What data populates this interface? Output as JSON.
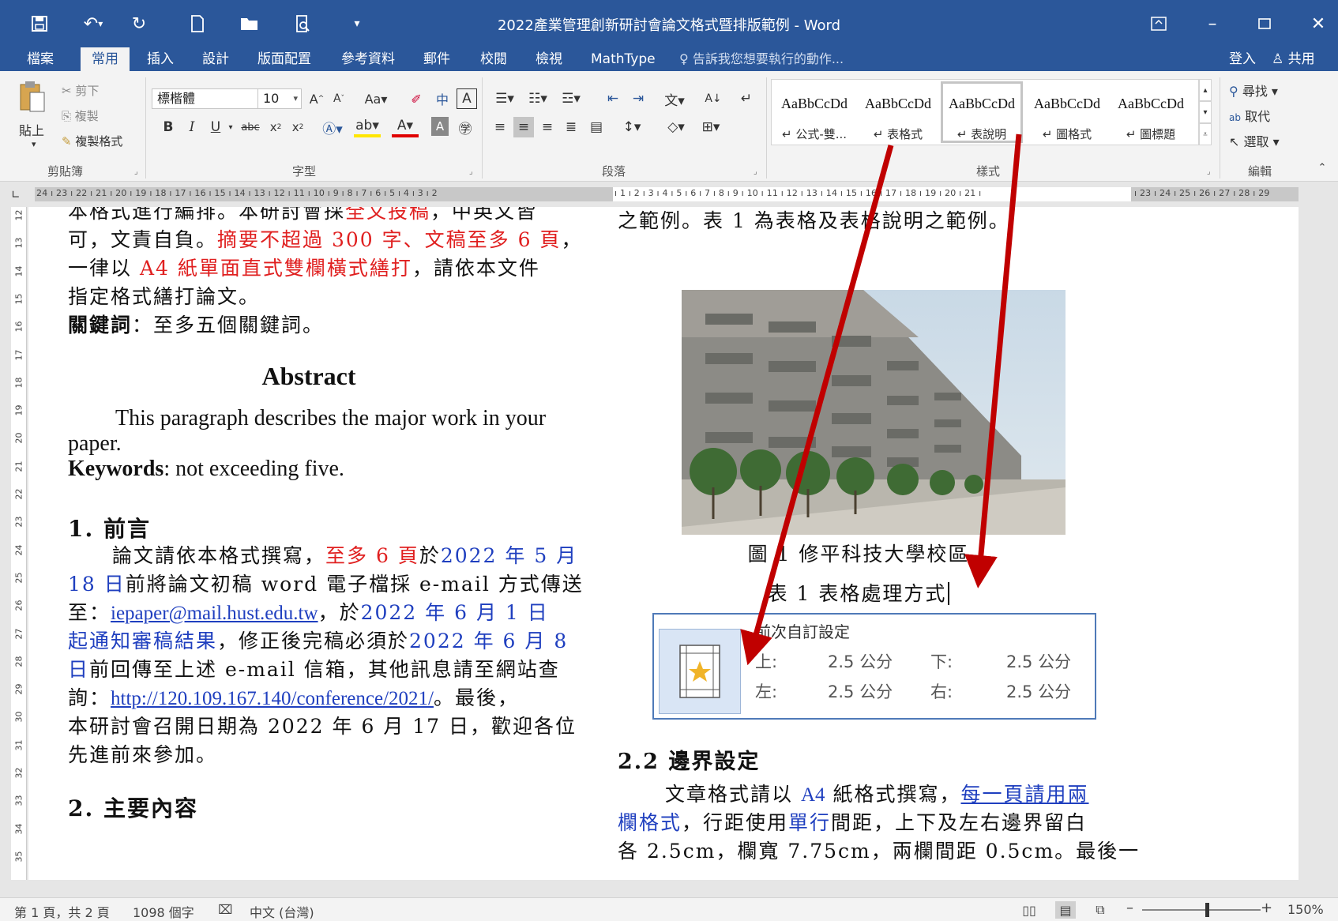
{
  "window": {
    "title": "2022產業管理創新研討會論文格式暨排版範例 - Word"
  },
  "tabs": [
    "檔案",
    "常用",
    "插入",
    "設計",
    "版面配置",
    "參考資料",
    "郵件",
    "校閱",
    "檢視",
    "MathType"
  ],
  "active_tab": "常用",
  "tell_me": "告訴我您想要執行的動作...",
  "signin": "登入",
  "share": "共用",
  "ribbon": {
    "clipboard": {
      "paste": "貼上",
      "cut": "剪下",
      "copy": "複製",
      "format_painter": "複製格式",
      "label": "剪貼簿"
    },
    "font": {
      "name": "標楷體",
      "size": "10",
      "label": "字型",
      "change_case": "Aa"
    },
    "paragraph": {
      "label": "段落"
    },
    "styles": {
      "label": "樣式",
      "items": [
        {
          "sample": "AaBbCcDd",
          "name": "公式-雙..."
        },
        {
          "sample": "AaBbCcDd",
          "name": "表格式"
        },
        {
          "sample": "AaBbCcDd",
          "name": "表說明"
        },
        {
          "sample": "AaBbCcDd",
          "name": "圖格式"
        },
        {
          "sample": "AaBbCcDd",
          "name": "圖標題"
        }
      ]
    },
    "editing": {
      "find": "尋找",
      "replace": "取代",
      "select": "選取",
      "label": "編輯"
    }
  },
  "ruler": {
    "left_nums": "24 ı 23 ı 22 ı 21 ı 20 ı 19 ı 18 ı 17 ı 16 ı 15 ı 14 ı 13 ı 12 ı 11 ı 10 ı 9 ı 8 ı 7 ı 6 ı 5 ı 4 ı 3 ı 2",
    "right_nums": "ı 1 ı 2 ı 3 ı 4 ı 5 ı 6 ı 7 ı 8 ı 9 ı 10 ı 11 ı 12 ı 13 ı 14 ı 15 ı 16 ı 17 ı 18 ı 19 ı 20 ı 21 ı",
    "end_nums": "ı 23 ı 24 ı 25 ı 26 ı 27 ı 28 ı 29",
    "vertical": [
      "12",
      "13",
      "14",
      "15",
      "16",
      "17",
      "18",
      "19",
      "20",
      "21",
      "22",
      "23",
      "24",
      "25",
      "26",
      "27",
      "28",
      "29",
      "30",
      "31",
      "32",
      "33",
      "34",
      "35"
    ]
  },
  "doc": {
    "left": {
      "l1a": "本格式進行編排。本研討會採",
      "l1b": "全文投稿",
      "l1c": "，中英文皆",
      "l2a": "可，文責自負。",
      "l2b": "摘要不超過 300 字、文稿至多 6 頁",
      "l2c": "，",
      "l3a": "一律以 ",
      "l3b": "A4 紙單面直式雙欄橫式繕打",
      "l3c": "，請依本文件",
      "l4": "指定格式繕打論文。",
      "kw_label": "關鍵詞",
      "kw_text": "：至多五個關鍵詞。",
      "abstract_title": "Abstract",
      "abs1": "This paragraph describes the major work in your",
      "abs2": "paper.",
      "kw_en_label": "Keywords",
      "kw_en_text": ": not exceeding five.",
      "h1": "1. 前言",
      "p1a": "論文請依本格式撰寫，",
      "p1b": "至多 6 頁",
      "p1c": "於",
      "p1d": "2022 年 5 月",
      "p2a": "18 日",
      "p2b": "前將論文初稿 word 電子檔採 e-mail 方式傳送",
      "p3a": "至：",
      "p3b": "iepaper@mail.hust.edu.tw",
      "p3c": "，於",
      "p3d": "2022 年 6 月 1 日",
      "p4a": "起通知審稿結果",
      "p4b": "，修正後完稿必須於",
      "p4c": "2022 年 6 月 8",
      "p5a": "日",
      "p5b": "前回傳至上述 e-mail 信箱，其他訊息請至網站查",
      "p6a": "詢：",
      "p6b": "http://120.109.167.140/conference/2021/",
      "p6c": "。最後，",
      "p7": "本研討會召開日期為 2022 年 6 月 17 日，歡迎各位",
      "p8": "先進前來參加。",
      "h2": "2. 主要內容"
    },
    "right": {
      "r1": "之範例。表 1 為表格及表格說明之範例。",
      "fig_caption": "圖 1  修平科技大學校區",
      "table_caption": "表 1  表格處理方式",
      "h22": "2.2  邊界設定",
      "s1a": "文章格式請以",
      "s1b": "A4",
      "s1c": "紙格式撰寫，",
      "s1d": "每一頁請用兩",
      "s2a": "欄格式",
      "s2b": "，行距使用",
      "s2c": "單行",
      "s2d": "間距，上下及左右邊界留白",
      "s3": "各 2.5cm，欄寬 7.75cm，兩欄間距 0.5cm。最後一"
    },
    "popup": {
      "title": "前次自訂設定",
      "top_label": "上:",
      "top_val": "2.5 公分",
      "bottom_label": "下:",
      "bottom_val": "2.5 公分",
      "left_label": "左:",
      "left_val": "2.5 公分",
      "right_label": "右:",
      "right_val": "2.5 公分"
    }
  },
  "status": {
    "page": "第 1 頁，共 2 頁",
    "words": "1098 個字",
    "lang": "中文 (台灣)",
    "zoom": "150%"
  },
  "colors": {
    "accent": "#2b579a",
    "arrow": "#c00000",
    "red_text": "#e02020",
    "blue_text": "#1f3fbf"
  }
}
